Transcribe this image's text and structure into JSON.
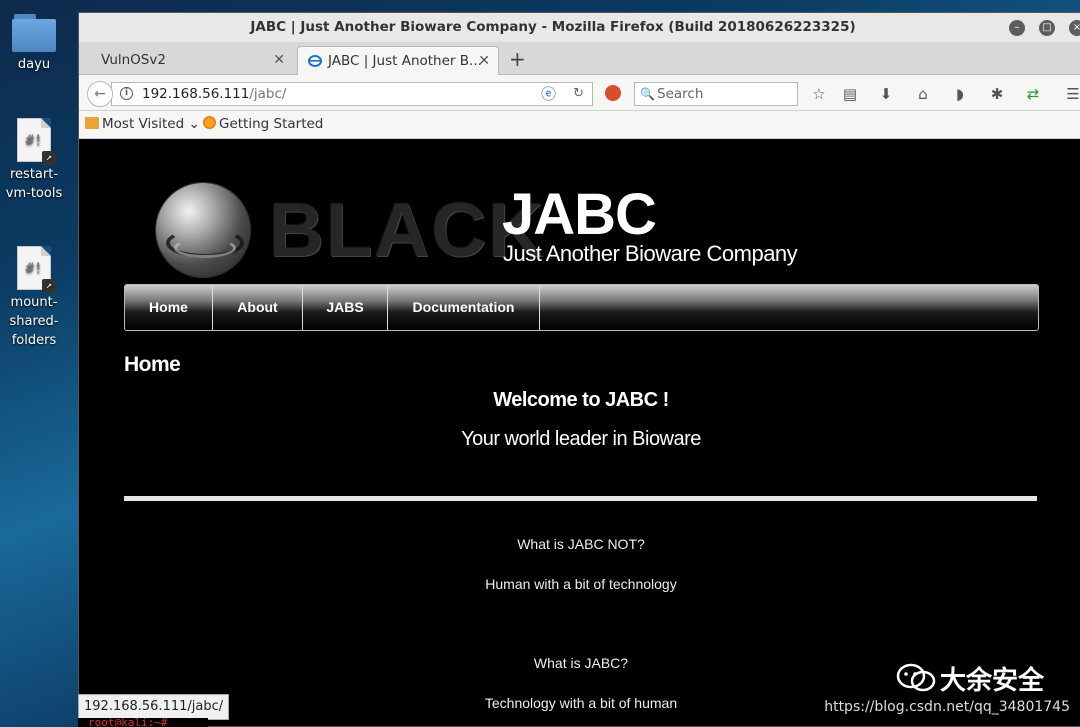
{
  "desktop": {
    "icons": [
      {
        "label": "dayu"
      },
      {
        "label": "restart-vm-tools"
      },
      {
        "label": "mount-shared-folders"
      }
    ]
  },
  "window": {
    "title": "JABC | Just Another Bioware Company - Mozilla Firefox (Build 20180626223325)"
  },
  "tabs": [
    {
      "label": "VulnOSv2"
    },
    {
      "label": "JABC | Just Another B..."
    }
  ],
  "url": {
    "host": "192.168.56.111",
    "path": "/jabc/"
  },
  "search": {
    "placeholder": "Search"
  },
  "bookmarks": [
    {
      "label": "Most Visited"
    },
    {
      "label": "Getting Started"
    }
  ],
  "site": {
    "logo_text": "BLACK",
    "title": "JABC",
    "slogan": "Just Another Bioware Company",
    "nav": [
      "Home",
      "About",
      "JABS",
      "Documentation"
    ],
    "page_heading": "Home",
    "welcome": "Welcome to JABC !",
    "tagline": "Your world leader in Bioware",
    "body_lines": [
      "What is JABC NOT?",
      "Human with a bit of technology",
      "What is JABC?",
      "Technology with a bit of human"
    ]
  },
  "status_url": "192.168.56.111/jabc/",
  "terminal_prompt": "root@kali:~#",
  "watermark": {
    "name": "大余安全",
    "url": "https://blog.csdn.net/qq_34801745"
  }
}
